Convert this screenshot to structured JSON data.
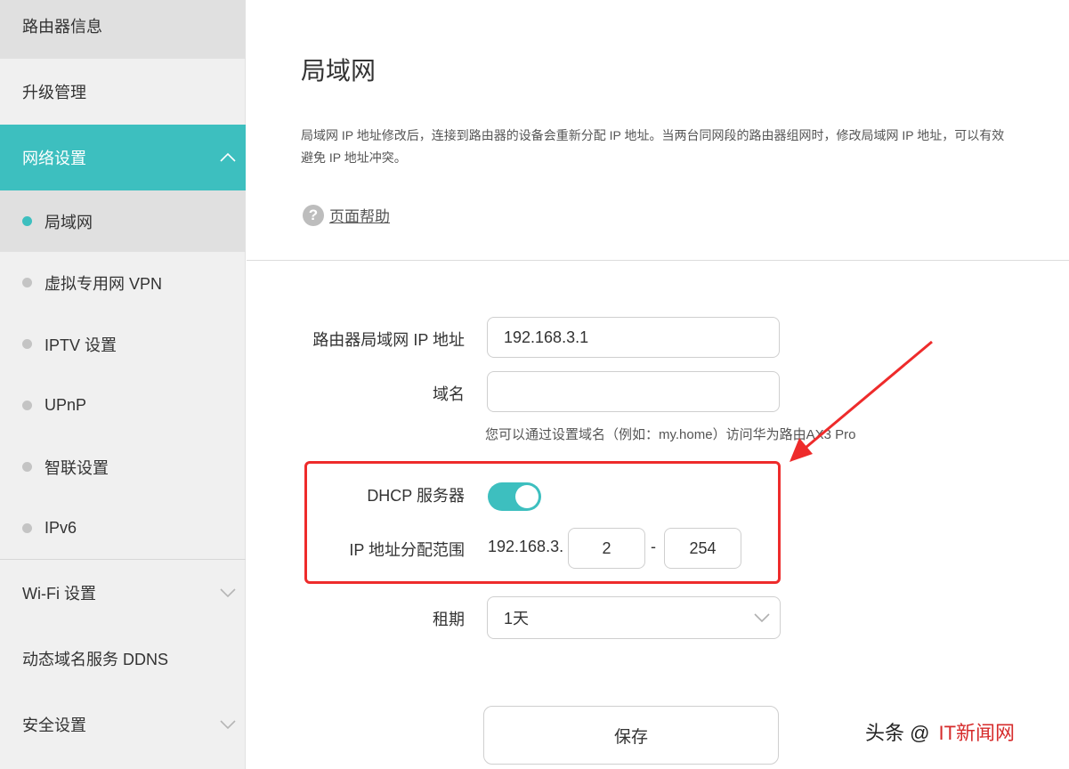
{
  "sidebar": {
    "top_item": "路由器信息",
    "upgrade": "升级管理",
    "network": "网络设置",
    "sub_items": [
      {
        "label": "局域网"
      },
      {
        "label": "虚拟专用网 VPN"
      },
      {
        "label": "IPTV 设置"
      },
      {
        "label": "UPnP"
      },
      {
        "label": "智联设置"
      },
      {
        "label": "IPv6"
      }
    ],
    "wifi": "Wi-Fi 设置",
    "ddns": "动态域名服务 DDNS",
    "security": "安全设置"
  },
  "main": {
    "title": "局域网",
    "description": "局域网 IP 地址修改后，连接到路由器的设备会重新分配 IP 地址。当两台同网段的路由器组网时，修改局域网 IP 地址，可以有效避免 IP 地址冲突。",
    "help_icon": "?",
    "help_link": "页面帮助",
    "form": {
      "lan_ip_label": "路由器局域网 IP 地址",
      "lan_ip_value": "192.168.3.1",
      "domain_label": "域名",
      "domain_value": "",
      "domain_hint": "您可以通过设置域名（例如：my.home）访问华为路由AX3 Pro",
      "dhcp_label": "DHCP 服务器",
      "dhcp_enabled": true,
      "range_label": "IP 地址分配范围",
      "range_prefix": "192.168.3.",
      "range_start": "2",
      "range_separator": "-",
      "range_end": "254",
      "lease_label": "租期",
      "lease_value": "1天",
      "save_label": "保存"
    }
  },
  "watermark": {
    "part1": "头条 @",
    "part2": "IT新闻网"
  },
  "colors": {
    "accent": "#3dbfbf",
    "highlight": "#ee2b2b"
  }
}
